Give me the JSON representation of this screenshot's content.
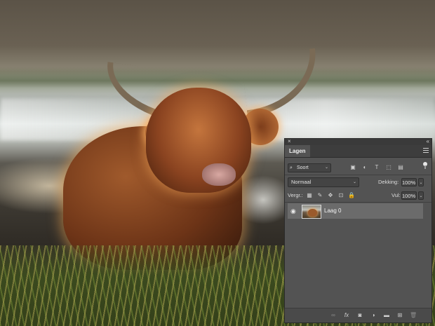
{
  "panel": {
    "close_glyph": "×",
    "collapse_glyph": "«",
    "tab_label": "Lagen",
    "filter": {
      "kind_label": "Soort",
      "icons": [
        "image-filter-icon",
        "adjustment-filter-icon",
        "type-filter-icon",
        "shape-filter-icon",
        "smartobject-filter-icon"
      ]
    },
    "blend_mode": "Normaal",
    "opacity_label": "Dekking:",
    "opacity_value": "100%",
    "lock_label": "Vergr.:",
    "fill_label": "Vul:",
    "fill_value": "100%",
    "layers": [
      {
        "name": "Laag 0",
        "visible": true,
        "selected": true
      }
    ],
    "footer_icons": [
      "link-layers-icon",
      "fx-icon",
      "add-mask-icon",
      "adjustment-layer-icon",
      "new-group-icon",
      "new-layer-icon",
      "delete-layer-icon"
    ],
    "glyphs": {
      "search": "⌕",
      "chev": "⌄",
      "image": "▣",
      "adjust": "◐",
      "type": "T",
      "shape": "⬚",
      "smart": "▤",
      "checker": "▦",
      "brush": "✎",
      "move": "✥",
      "artboard": "⊡",
      "padlock": "🔒",
      "eye": "◉",
      "link": "∞",
      "fx": "fx",
      "mask": "◙",
      "adjustlayer": "◑",
      "folder": "▬",
      "newlayer": "⊞",
      "trash": "🗑"
    }
  },
  "colors": {
    "panel_bg": "#535353",
    "panel_header": "#3d3d3d",
    "selected_row": "#6b6b6b",
    "text": "#dcdcdc"
  }
}
